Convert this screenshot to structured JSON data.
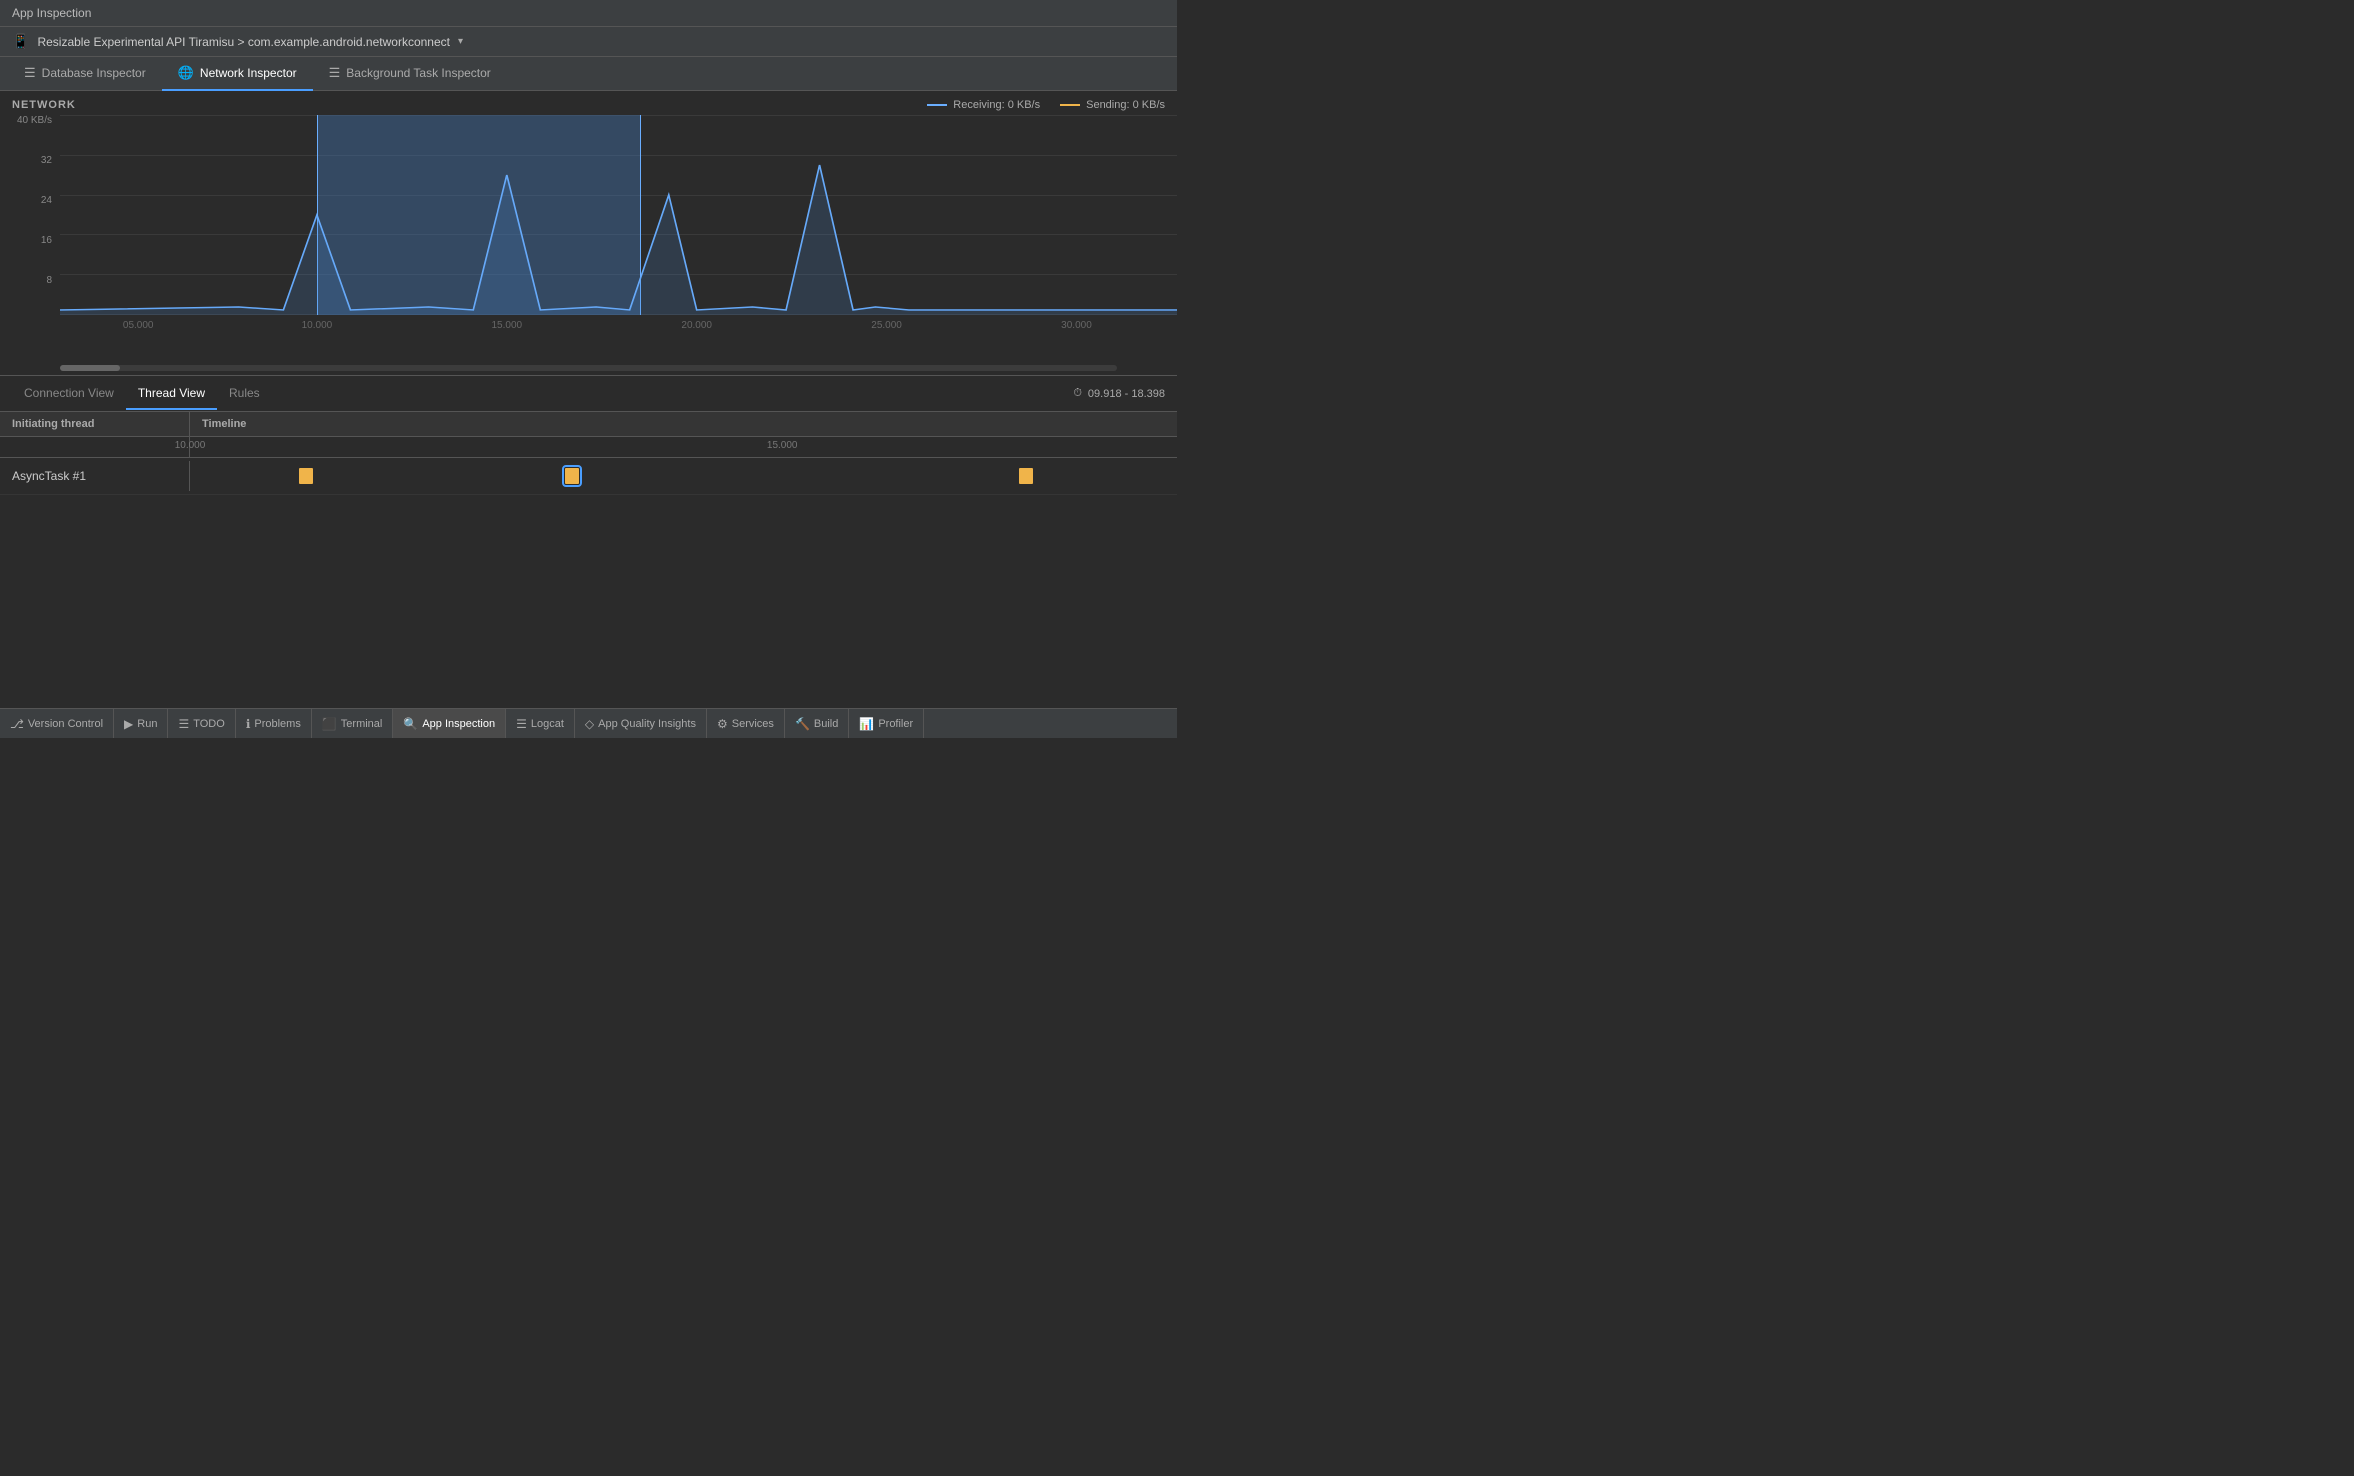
{
  "titleBar": {
    "label": "App Inspection"
  },
  "deviceBar": {
    "icon": "📱",
    "label": "Resizable Experimental API Tiramisu > com.example.android.networkconnect",
    "chevron": "▾"
  },
  "tabs": [
    {
      "id": "database",
      "label": "Database Inspector",
      "icon": "☰",
      "active": false
    },
    {
      "id": "network",
      "label": "Network Inspector",
      "icon": "🌐",
      "active": true
    },
    {
      "id": "background",
      "label": "Background Task Inspector",
      "icon": "☰",
      "active": false
    }
  ],
  "chart": {
    "title": "NETWORK",
    "yAxisLabel": "40 KB/s",
    "yTicks": [
      "40",
      "32",
      "24",
      "16",
      "8",
      ""
    ],
    "xTicks": [
      {
        "label": "05.000",
        "pct": 7
      },
      {
        "label": "10.000",
        "pct": 23
      },
      {
        "label": "15.000",
        "pct": 40
      },
      {
        "label": "20.000",
        "pct": 57
      },
      {
        "label": "25.000",
        "pct": 74
      },
      {
        "label": "30.000",
        "pct": 91
      }
    ],
    "legend": {
      "receiving": {
        "label": "Receiving: 0 KB/s",
        "color": "#6aaeff"
      },
      "sending": {
        "label": "Sending: 0 KB/s",
        "color": "#f0b44a"
      }
    },
    "selectionStart": 23,
    "selectionEnd": 52
  },
  "viewTabs": [
    {
      "id": "connection",
      "label": "Connection View",
      "active": false
    },
    {
      "id": "thread",
      "label": "Thread View",
      "active": true
    },
    {
      "id": "rules",
      "label": "Rules",
      "active": false
    }
  ],
  "timeRange": {
    "icon": "⏱",
    "value": "09.918 - 18.398"
  },
  "threadTable": {
    "headers": {
      "initiating": "Initiating thread",
      "timeline": "Timeline"
    },
    "rulerTicks": [
      {
        "label": "10.000",
        "pct": 0
      },
      {
        "label": "15.000",
        "pct": 60
      }
    ],
    "rows": [
      {
        "name": "AsyncTask #1",
        "tasks": [
          {
            "pct": 11,
            "selected": false
          },
          {
            "pct": 38,
            "selected": true
          },
          {
            "pct": 84,
            "selected": false
          }
        ]
      }
    ]
  },
  "statusBar": {
    "items": [
      {
        "id": "version-control",
        "icon": "⎇",
        "label": "Version Control"
      },
      {
        "id": "run",
        "icon": "▶",
        "label": "Run"
      },
      {
        "id": "todo",
        "icon": "☰",
        "label": "TODO"
      },
      {
        "id": "problems",
        "icon": "ℹ",
        "label": "Problems"
      },
      {
        "id": "terminal",
        "icon": "⬛",
        "label": "Terminal"
      },
      {
        "id": "app-inspection",
        "icon": "🔍",
        "label": "App Inspection",
        "active": true
      },
      {
        "id": "logcat",
        "icon": "☰",
        "label": "Logcat"
      },
      {
        "id": "app-quality",
        "icon": "◇",
        "label": "App Quality Insights"
      },
      {
        "id": "services",
        "icon": "⚙",
        "label": "Services"
      },
      {
        "id": "build",
        "icon": "🔨",
        "label": "Build"
      },
      {
        "id": "profiler",
        "icon": "📊",
        "label": "Profiler"
      }
    ]
  }
}
